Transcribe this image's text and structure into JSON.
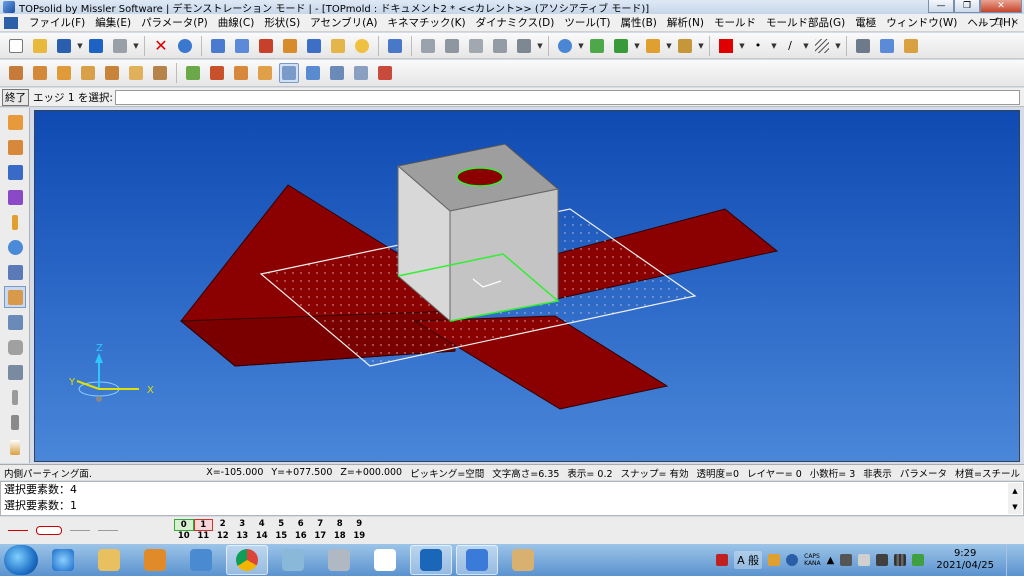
{
  "window": {
    "title": "TOPsolid by Missler Software | デモンストレーション モード | - [TOPmold : ドキュメント2 *  <<カレント>> (アソシアティブ モード)]"
  },
  "menu": [
    "ファイル(F)",
    "編集(E)",
    "パラメータ(P)",
    "曲線(C)",
    "形状(S)",
    "アセンブリ(A)",
    "キネマチック(K)",
    "ダイナミクス(D)",
    "ツール(T)",
    "属性(B)",
    "解析(N)",
    "モールド",
    "モールド部品(G)",
    "電極",
    "ウィンドウ(W)",
    "ヘルプ(H)"
  ],
  "command": {
    "end_label": "終了",
    "prompt": "エッジ 1 を選択:"
  },
  "viewport": {
    "axes": {
      "x": "X",
      "y": "Y",
      "z": "Z"
    },
    "colors": {
      "background_top": "#0f4ab2",
      "plate": "#8b0000",
      "box": "#c8c8c8",
      "selection": "#33ee33"
    }
  },
  "status": {
    "mode": "内側パーティング面.",
    "x": "X=-105.000",
    "y": "Y=+077.500",
    "z": "Z=+000.000",
    "picking": "ピッキング=空間",
    "text_height": "文字高さ=6.35",
    "display": "表示=   0.2",
    "snap": "スナップ= 有効",
    "transparency": "透明度=0",
    "layer": "レイヤー=  0",
    "decimals": "小数桁= 3",
    "hide": "非表示",
    "parameter": "パラメータ",
    "material": "材質=スチール"
  },
  "messages": [
    "選択要素数：4",
    "選択要素数：1"
  ],
  "layers": {
    "row1": [
      "0",
      "1",
      "2",
      "3",
      "4",
      "5",
      "6",
      "7",
      "8",
      "9"
    ],
    "row2": [
      "10",
      "11",
      "12",
      "13",
      "14",
      "15",
      "16",
      "17",
      "18",
      "19"
    ]
  },
  "taskbar": {
    "ime": "A 般",
    "caps": "CAPS",
    "kana": "KANA",
    "time": "9:29",
    "date": "2021/04/25"
  }
}
